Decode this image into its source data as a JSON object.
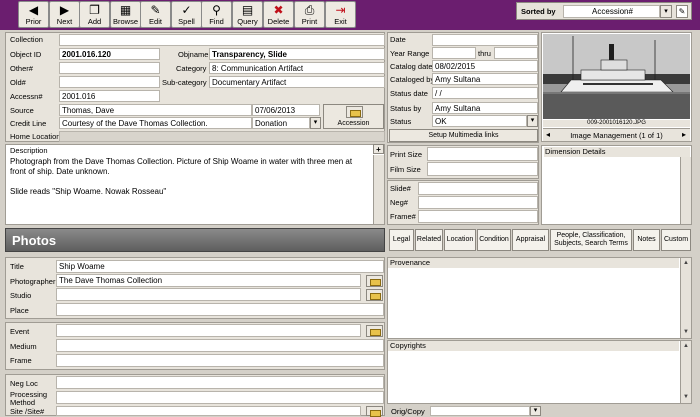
{
  "toolbar": {
    "buttons": [
      {
        "id": "prior",
        "label": "Prior",
        "icon": "◀"
      },
      {
        "id": "next",
        "label": "Next",
        "icon": "▶"
      },
      {
        "id": "add",
        "label": "Add",
        "icon": "❐"
      },
      {
        "id": "browse",
        "label": "Browse",
        "icon": "▦"
      },
      {
        "id": "edit",
        "label": "Edit",
        "icon": "✎"
      },
      {
        "id": "spell",
        "label": "Spell",
        "icon": "✓"
      },
      {
        "id": "find",
        "label": "Find",
        "icon": "⚲"
      },
      {
        "id": "query",
        "label": "Query",
        "icon": "▤"
      },
      {
        "id": "delete",
        "label": "Delete",
        "icon": "✖"
      },
      {
        "id": "print",
        "label": "Print",
        "icon": "⎙"
      },
      {
        "id": "exit",
        "label": "Exit",
        "icon": "⇥"
      }
    ],
    "sorted_by_label": "Sorted by",
    "sorted_by_value": "Accession#"
  },
  "form": {
    "collection_label": "Collection",
    "collection_value": "",
    "object_id_label": "Object ID",
    "object_id_value": "2001.016.120",
    "objname_label": "Objname",
    "objname_value": "Transparency, Slide",
    "other_label": "Other#",
    "other_value": "",
    "category_label": "Category",
    "category_value": "8: Communication Artifact",
    "old_label": "Old#",
    "old_value": "",
    "subcategory_label": "Sub-category",
    "subcategory_value": "Documentary Artifact",
    "accession_label": "Accessn#",
    "accession_value": "2001.016",
    "source_label": "Source",
    "source_value": "Thomas, Dave",
    "source_date": "07/06/2013",
    "credit_label": "Credit Line",
    "credit_value": "Courtesy of the Dave Thomas Collection.",
    "credit_type": "Donation",
    "accession_button": "Accession",
    "home_location_label": "Home Location",
    "home_location_value": "",
    "description_label": "Description",
    "description_text": "Photograph from the Dave Thomas Collection. Picture of Ship Woame in water with three men at front of ship. Date unknown.",
    "description_text2": "Slide reads \"Ship Woame. Nowak Rosseau\""
  },
  "dates": {
    "date_label": "Date",
    "date_value": "",
    "year_range_label": "Year Range",
    "year_thru": "thru",
    "catalog_date_label": "Catalog date",
    "catalog_date_value": "08/02/2015",
    "cataloged_by_label": "Cataloged by",
    "cataloged_by_value": "Amy Sultana",
    "status_date_label": "Status date",
    "status_date_value": " / /",
    "status_by_label": "Status by",
    "status_by_value": "Amy Sultana",
    "status_label": "Status",
    "status_value": "OK",
    "multimedia_button": "Setup Multimedia links",
    "print_size_label": "Print Size",
    "film_size_label": "Film Size",
    "slide_label": "Slide#",
    "neg_label": "Neg#",
    "frame_label": "Frame#"
  },
  "image": {
    "filename": "009-2001016120.JPG",
    "management_label": "Image Management (1 of 1)",
    "dimension_label": "Dimension Details"
  },
  "section": {
    "title": "Photos",
    "tabs": [
      "Legal",
      "Related",
      "Location",
      "Condition",
      "Appraisal",
      "People, Classification, Subjects, Search Terms",
      "Notes",
      "Custom"
    ]
  },
  "photos": {
    "title_label": "Title",
    "title_value": "Ship Woame",
    "photographer_label": "Photographer",
    "photographer_value": "The Dave Thomas Collection",
    "studio_label": "Studio",
    "place_label": "Place",
    "event_label": "Event",
    "medium_label": "Medium",
    "frame_label": "Frame",
    "negloc_label": "Neg Loc",
    "processing_label": "Processing Method",
    "site_label": "Site /Site#",
    "provenance_label": "Provenance",
    "copyrights_label": "Copyrights",
    "origcopy_label": "Orig/Copy"
  },
  "colors": {
    "title_bar": "#6b1e6f",
    "section_bar": "#6f6f6f"
  }
}
